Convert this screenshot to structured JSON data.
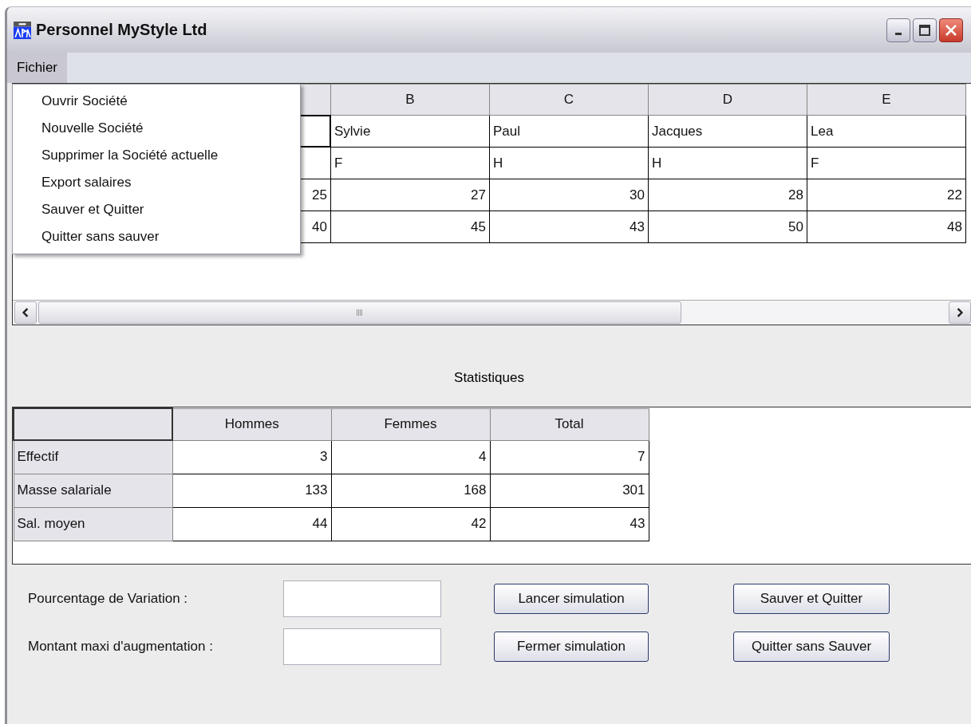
{
  "window": {
    "title": "Personnel MyStyle Ltd"
  },
  "menu_bar": [
    {
      "label": "Fichier",
      "selected": true
    }
  ],
  "menu": {
    "items": [
      "Ouvrir Société",
      "Nouvelle Société",
      "Supprimer la Société actuelle",
      "Export salaires",
      "Sauver et Quitter",
      "Quitter sans sauver"
    ]
  },
  "grid": {
    "columns": [
      "B",
      "C",
      "D",
      "E"
    ],
    "rows": [
      {
        "kind": "text",
        "column_a_selected": true,
        "cells": [
          "Sylvie",
          "Paul",
          "Jacques",
          "Lea"
        ]
      },
      {
        "kind": "text",
        "column_a_selected": false,
        "cells": [
          "F",
          "H",
          "H",
          "F"
        ]
      },
      {
        "kind": "number",
        "column_a_selected": false,
        "column_a_cell": "25",
        "cells": [
          "27",
          "30",
          "28",
          "22"
        ]
      },
      {
        "kind": "number",
        "column_a_selected": false,
        "column_a_cell": "40",
        "cells": [
          "45",
          "43",
          "50",
          "48"
        ]
      }
    ]
  },
  "stats": {
    "title": "Statistiques",
    "columns": [
      "Hommes",
      "Femmes",
      "Total"
    ],
    "rows": [
      {
        "label": "Effectif",
        "values": [
          "3",
          "4",
          "7"
        ]
      },
      {
        "label": "Masse salariale",
        "values": [
          "133",
          "168",
          "301"
        ]
      },
      {
        "label": "Sal. moyen",
        "values": [
          "44",
          "42",
          "43"
        ]
      }
    ]
  },
  "form": {
    "rows": [
      {
        "label": "Pourcentage de Variation :",
        "buttons": [
          "Lancer simulation",
          "Sauver et Quitter"
        ]
      },
      {
        "label": "Montant maxi d'augmentation :",
        "buttons": [
          "Fermer simulation",
          "Quitter sans Sauver"
        ]
      }
    ]
  }
}
